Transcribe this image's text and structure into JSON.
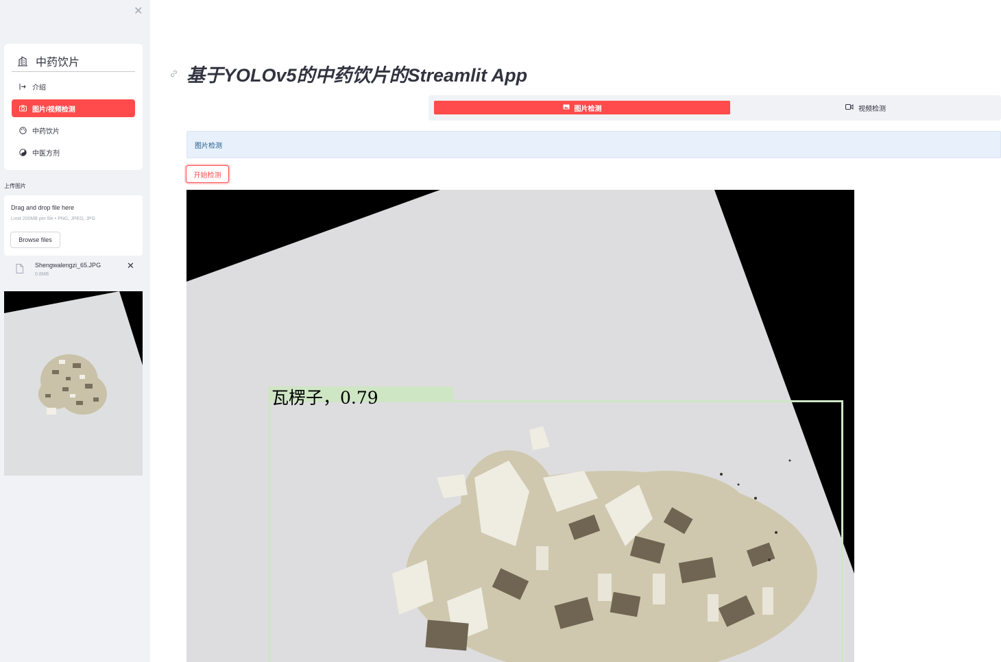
{
  "sidebar": {
    "close_icon": "close-icon",
    "menu": {
      "title": "中药饮片",
      "title_icon": "building-icon",
      "items": [
        {
          "label": "介绍",
          "icon": "login-arrow-icon"
        },
        {
          "label": "图片/视频检测",
          "icon": "camera-icon",
          "active": true
        },
        {
          "label": "中药饮片",
          "icon": "palette-icon"
        },
        {
          "label": "中医方剂",
          "icon": "yin-yang-icon"
        }
      ]
    },
    "upload": {
      "label": "上传图片",
      "drag_text": "Drag and drop file here",
      "limit_text": "Limit 200MB per file • PNG, JPEG, JPG",
      "browse_label": "Browse files",
      "file_name": "Shengwalengzi_65.JPG",
      "file_size": "0.8MB"
    }
  },
  "main": {
    "title": "基于YOLOv5的中药饮片的Streamlit App",
    "tabs": [
      {
        "label": "图片检测",
        "icon": "image-icon",
        "active": true
      },
      {
        "label": "视频检测",
        "icon": "video-icon",
        "active": false
      }
    ],
    "info_text": "图片检测",
    "detect_button": "开始检测",
    "detection_label": "瓦楞子，0.79"
  },
  "colors": {
    "accent": "#ff4b4b",
    "sidebar_bg": "#f0f2f6",
    "info_bg": "#e8f0fb",
    "box_color": "#cfe6c5"
  }
}
